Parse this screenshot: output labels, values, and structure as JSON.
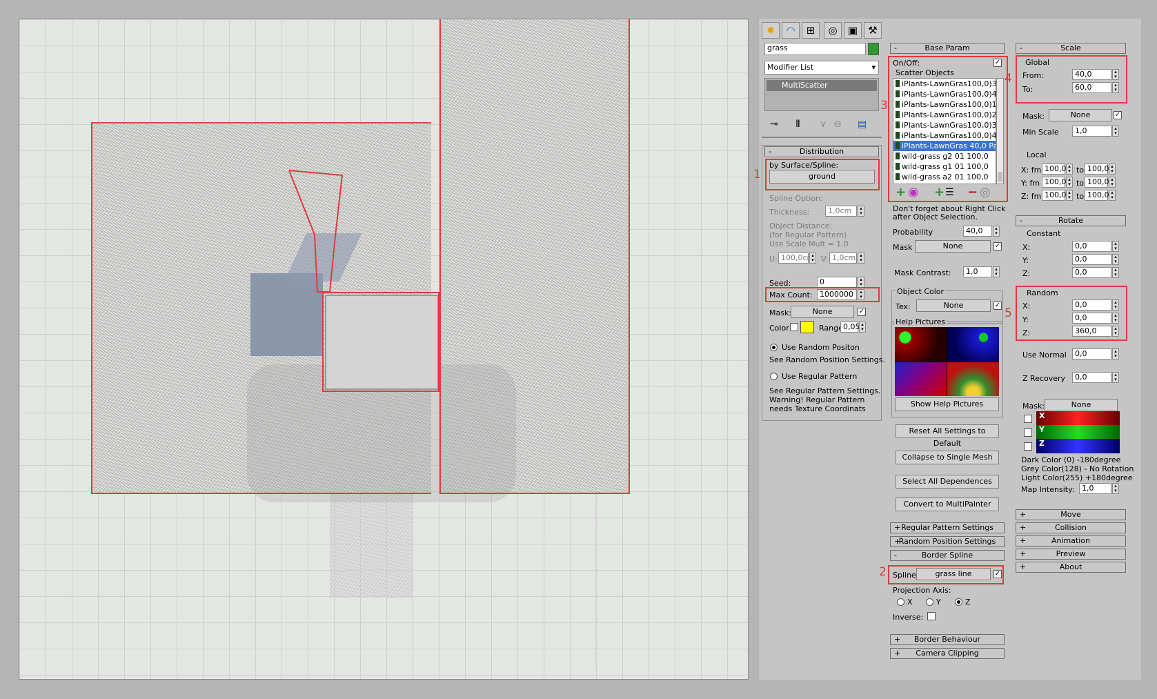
{
  "toolbar": {
    "tabs": [
      "create-icon",
      "modify-icon",
      "hierarchy-icon",
      "motion-icon",
      "display-icon",
      "utilities-icon"
    ]
  },
  "modifier": {
    "object_name": "grass",
    "name_color": "#2f9a2f",
    "modifier_list": "Modifier List",
    "stack_item": "MultiScatter"
  },
  "callouts": [
    "1",
    "2",
    "3",
    "4",
    "5"
  ],
  "distribution": {
    "title": "Distribution",
    "by_surface": "by Surface/Spline:",
    "surface_button": "ground",
    "spline_option": "Spline Option:",
    "thickness_label": "Thickness:",
    "thickness_value": "1,0cm",
    "object_distance": "Object Distance:",
    "regular_pattern_note": "(for Regular Pattern)",
    "scale_mult_note": "Use Scale Mult = 1.0",
    "u_label": "U:",
    "u_value": "100,0cr",
    "v_label": "V:",
    "v_value": "1,0cm",
    "seed_label": "Seed:",
    "seed_value": "0",
    "max_count_label": "Max Count:",
    "max_count_value": "1000000",
    "mask_label": "Mask:",
    "mask_value": "None",
    "color_label": "Color",
    "color_swatch": "#ffff00",
    "range_label": "Range",
    "range_value": "0,05",
    "random_pos_label": "Use Random Positon",
    "random_pos_note": "See Random Position Settings.",
    "regular_label": "Use Regular Pattern",
    "regular_note1": "See Regular Pattern Settings.",
    "regular_note2": "Warning! Regular Pattern",
    "regular_note3": "needs Texture Coordinats"
  },
  "base": {
    "title": "Base Param",
    "onoff": "On/Off:",
    "scatter_objects": "Scatter Objects",
    "items": [
      "iPlants-LawnGras100,0)3",
      "iPlants-LawnGras100,0)4",
      "iPlants-LawnGras100,0)1",
      "iPlants-LawnGras100,0)2",
      "iPlants-LawnGras100,0)3",
      "iPlants-LawnGras100,0)4",
      "iPlants-LawnGras 40,0 Pa",
      "wild-grass g2 01  100,0",
      "wild-grass g1 01  100,0",
      "wild-grass a2 01  100,0"
    ],
    "selected_index": 6,
    "warning1": "Don't forget about Right Click",
    "warning2": "after Object Selection.",
    "probability_label": "Probability",
    "probability_value": "40,0",
    "mask_label": "Mask",
    "mask_value": "None",
    "mask_contrast_label": "Mask Contrast:",
    "mask_contrast_value": "1,0",
    "object_color": "Object Color",
    "tex_label": "Tex:",
    "tex_value": "None",
    "help_pictures": "Help Pictures",
    "show_help": "Show Help Pictures",
    "reset": "Reset All Settings to Default",
    "collapse": "Collapse to Single Mesh",
    "select_deps": "Select All Dependences",
    "convert": "Convert to MultiPainter",
    "regular_pattern_settings": "Regular Pattern Settings",
    "random_position_settings": "Random Position Settings",
    "border_spline": "Border Spline",
    "spline_label": "Spline:",
    "spline_value": "grass line",
    "projection_axis": "Projection Axis:",
    "axis_x": "X",
    "axis_y": "Y",
    "axis_z": "Z",
    "inverse": "Inverse:",
    "border_behaviour": "Border Behaviour",
    "camera_clipping": "Camera Clipping"
  },
  "scale": {
    "title": "Scale",
    "global": "Global",
    "from_label": "From:",
    "from_value": "40,0",
    "to_label": "To:",
    "to_value": "60,0",
    "mask_label": "Mask:",
    "mask_value": "None",
    "min_scale_label": "Min Scale",
    "min_scale_value": "1,0",
    "local": "Local",
    "x_fm": "X: fm",
    "y_fm": "Y: fm",
    "z_fm": "Z: fm",
    "to": "to",
    "local_val": "100,0"
  },
  "rotate": {
    "title": "Rotate",
    "constant": "Constant",
    "x": "X:",
    "y": "Y:",
    "z": "Z:",
    "cx": "0,0",
    "cy": "0,0",
    "cz": "0,0",
    "random": "Random",
    "rx": "0,0",
    "ry": "0,0",
    "rz": "360,0",
    "use_normal": "Use Normal",
    "use_normal_value": "0,0",
    "z_recovery": "Z Recovery",
    "z_recovery_value": "0,0",
    "mask_label": "Mask:",
    "mask_value": "None",
    "dark": "Dark Color (0)    -180degree",
    "grey": "Grey Color(128) - No Rotation",
    "light": "Light Color(255)  +180degree",
    "map_intensity_label": "Map Intensity:",
    "map_intensity_value": "1,0"
  },
  "rollouts": [
    "Move",
    "Collision",
    "Animation",
    "Preview",
    "About"
  ]
}
